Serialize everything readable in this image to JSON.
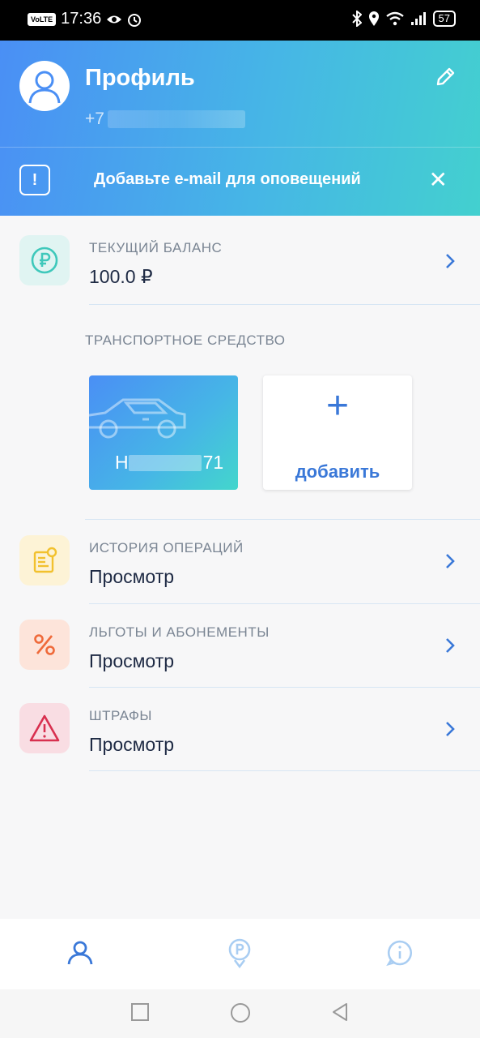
{
  "status_bar": {
    "time": "17:36",
    "volte": "VoLTE",
    "battery": "57"
  },
  "header": {
    "title": "Профиль",
    "phone_prefix": "+7",
    "notice_text": "Добавьте e-mail для оповещений",
    "notice_icon": "!",
    "close_glyph": "✕"
  },
  "balance": {
    "label": "ТЕКУЩИЙ БАЛАНС",
    "value": "100.0 ₽"
  },
  "vehicles": {
    "title": "ТРАНСПОРТНОЕ СРЕДСТВО",
    "plate_start": "Н",
    "plate_end": "71",
    "add_label": "добавить",
    "add_glyph": "+"
  },
  "menu": [
    {
      "label": "ИСТОРИЯ ОПЕРАЦИЙ",
      "value": "Просмотр",
      "icon": "receipt-icon",
      "color": "#f2c12e",
      "bg": "#fdf3d6"
    },
    {
      "label": "ЛЬГОТЫ И АБОНЕМЕНТЫ",
      "value": "Просмотр",
      "icon": "percent-icon",
      "color": "#ef6a3a",
      "bg": "#fde4da"
    },
    {
      "label": "ШТРАФЫ",
      "value": "Просмотр",
      "icon": "warning-icon",
      "color": "#d8304f",
      "bg": "#f9dde3"
    }
  ],
  "colors": {
    "accent": "#3a78d8",
    "header_start": "#4a8ff5",
    "header_end": "#43d0cf",
    "teal": "#3fc8bb"
  }
}
